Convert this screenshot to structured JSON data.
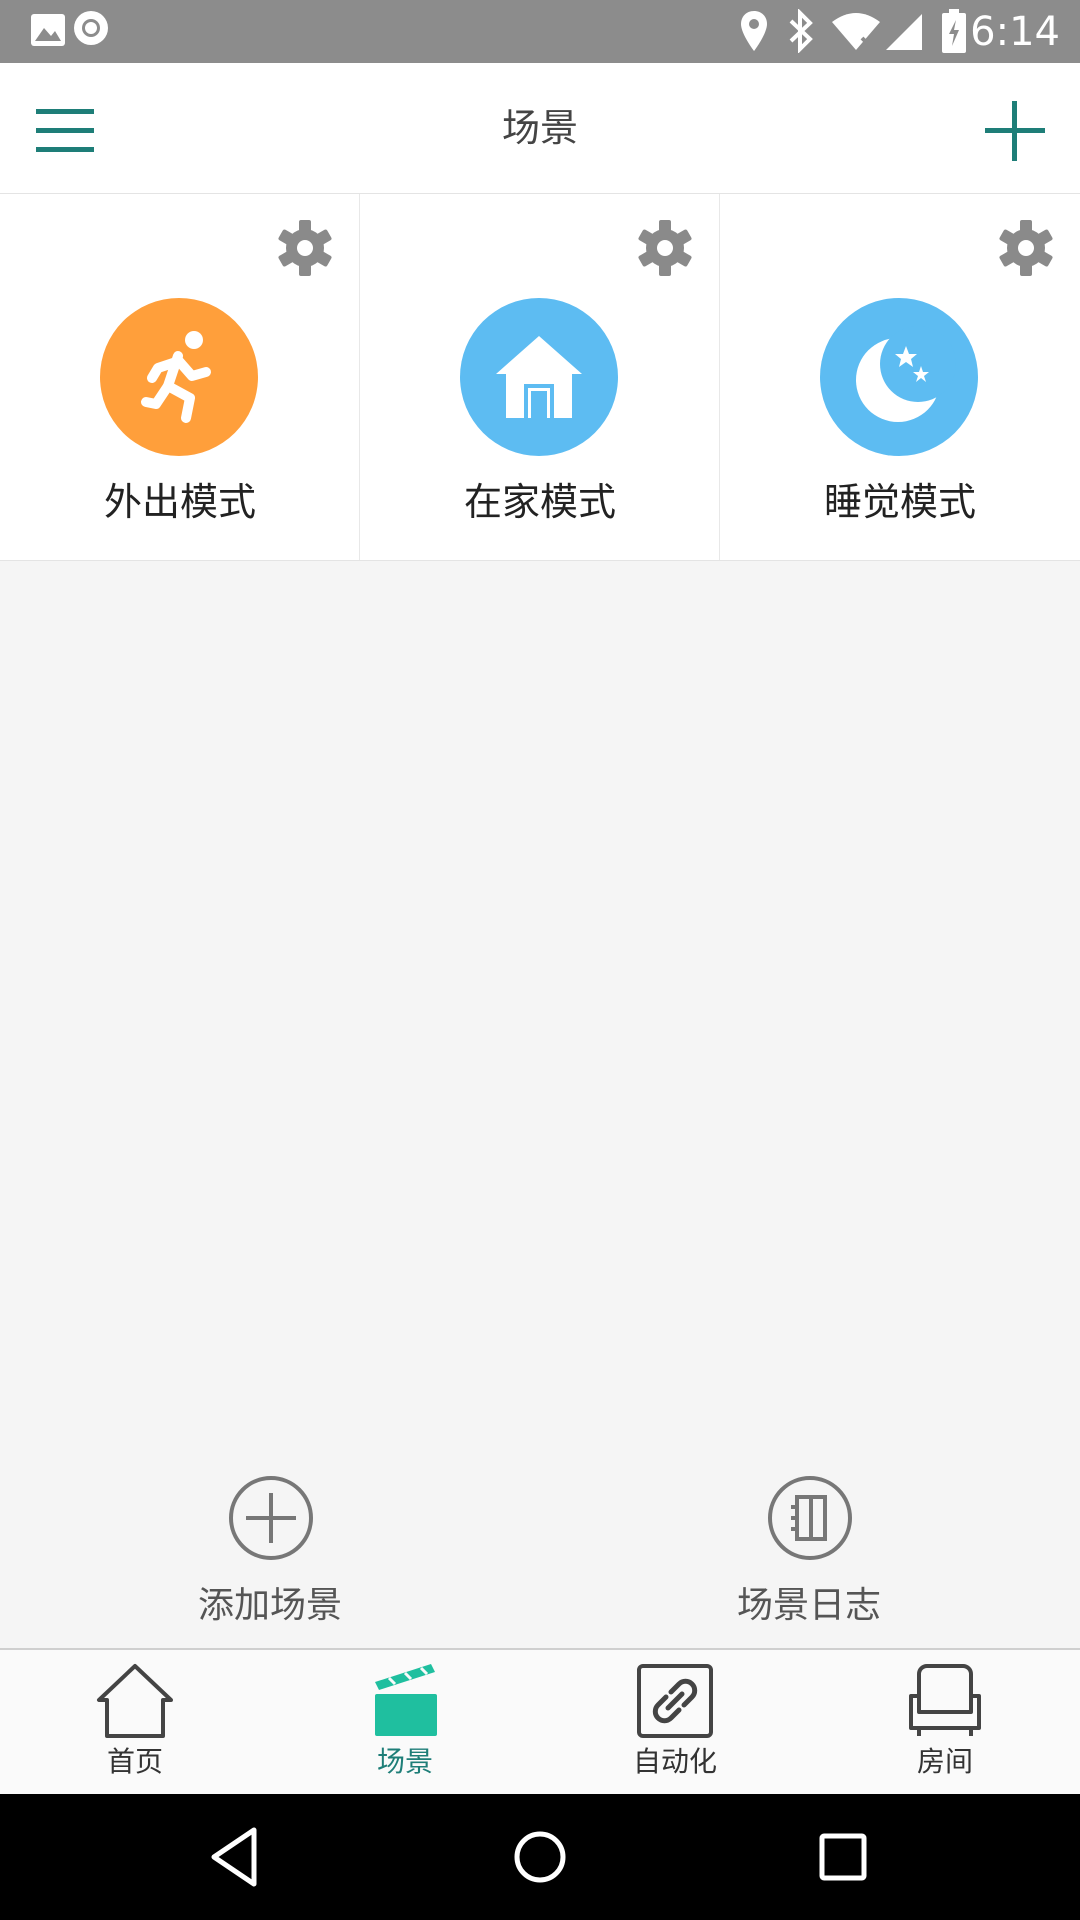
{
  "status_bar": {
    "time": "6:14"
  },
  "app_bar": {
    "title": "场景"
  },
  "scenes": [
    {
      "label": "外出模式",
      "icon": "running-person-icon",
      "color": "#ff9f3b"
    },
    {
      "label": "在家模式",
      "icon": "house-icon",
      "color": "#5dbcf2"
    },
    {
      "label": "睡觉模式",
      "icon": "moon-stars-icon",
      "color": "#5dbcf2"
    }
  ],
  "actions": {
    "add_scene": "添加场景",
    "scene_log": "场景日志"
  },
  "bottom_nav": {
    "home": "首页",
    "scene": "场景",
    "automation": "自动化",
    "room": "房间",
    "active": "场景"
  },
  "colors": {
    "accent": "#1e7e78",
    "active_tab_icon": "#1fbf9f",
    "status_bar": "#8c8c8c"
  }
}
